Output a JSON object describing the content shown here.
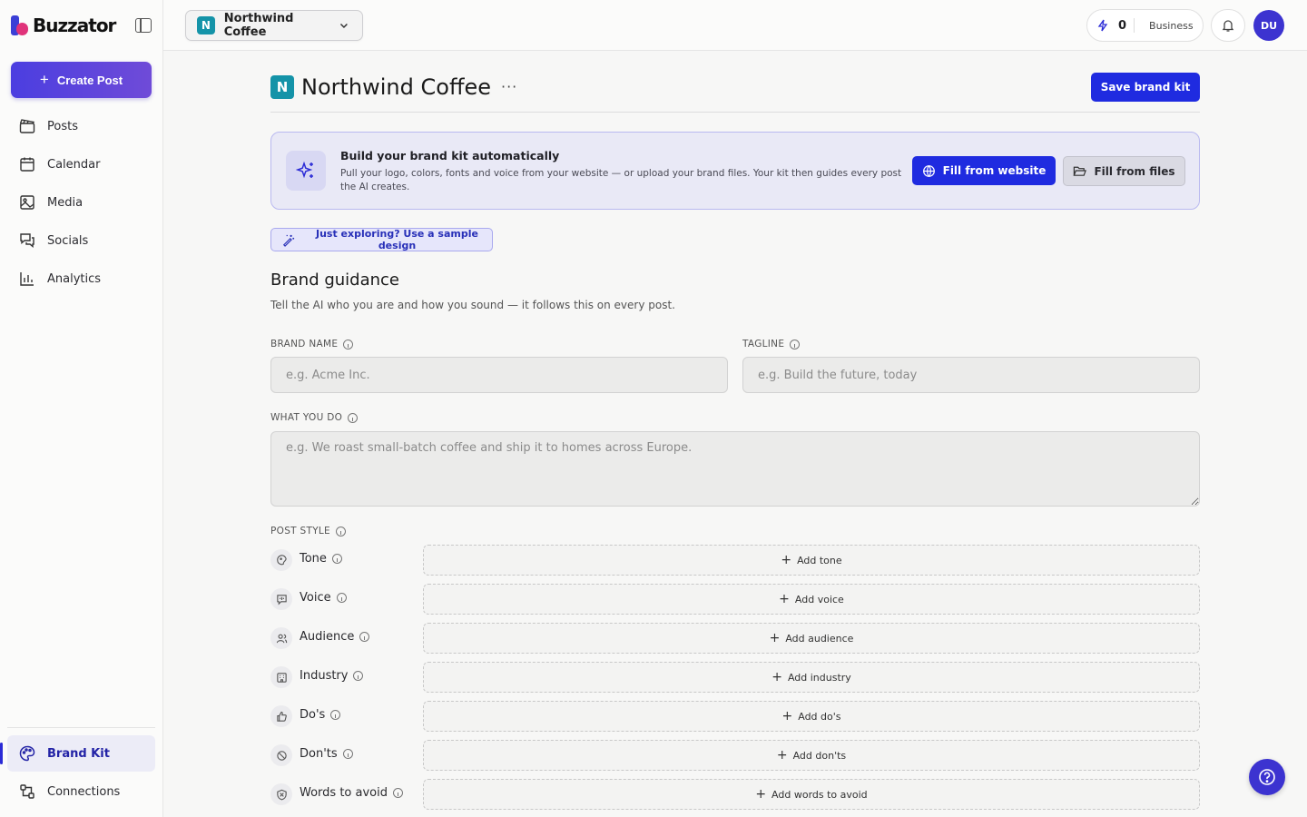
{
  "app": {
    "logo_text": "Buzzator"
  },
  "sidebar": {
    "create_label": "Create Post",
    "items": [
      {
        "label": "Posts",
        "icon": "clapperboard-icon"
      },
      {
        "label": "Calendar",
        "icon": "calendar-icon"
      },
      {
        "label": "Media",
        "icon": "image-icon"
      },
      {
        "label": "Socials",
        "icon": "chat-icon"
      },
      {
        "label": "Analytics",
        "icon": "bar-chart-icon"
      }
    ],
    "bottom_items": [
      {
        "label": "Brand Kit",
        "icon": "palette-icon",
        "active": true
      },
      {
        "label": "Connections",
        "icon": "connections-icon"
      }
    ]
  },
  "topbar": {
    "workspace_initial": "N",
    "workspace_name": "Northwind Coffee",
    "credits": "0",
    "plan": "Business",
    "avatar": "DU"
  },
  "page": {
    "initial": "N",
    "title": "Northwind Coffee",
    "more": "···",
    "save_label": "Save brand kit"
  },
  "auto": {
    "title": "Build your brand kit automatically",
    "desc": "Pull your logo, colors, fonts and voice from your website — or upload your brand files. Your kit then guides every post the AI creates.",
    "fill_web": "Fill from website",
    "fill_files": "Fill from files"
  },
  "sample_label": "Just exploring? Use a sample design",
  "guidance": {
    "title": "Brand guidance",
    "subtitle": "Tell the AI who you are and how you sound — it follows this on every post.",
    "brand_name_label": "BRAND NAME",
    "brand_name_placeholder": "e.g. Acme Inc.",
    "tagline_label": "TAGLINE",
    "tagline_placeholder": "e.g. Build the future, today",
    "what_label": "WHAT YOU DO",
    "what_placeholder": "e.g. We roast small-batch coffee and ship it to homes across Europe.",
    "post_style_label": "POST STYLE",
    "style_rows": [
      {
        "label": "Tone",
        "add": "Add tone",
        "icon": "tone-icon"
      },
      {
        "label": "Voice",
        "add": "Add voice",
        "icon": "voice-icon"
      },
      {
        "label": "Audience",
        "add": "Add audience",
        "icon": "audience-icon"
      },
      {
        "label": "Industry",
        "add": "Add industry",
        "icon": "industry-icon"
      },
      {
        "label": "Do's",
        "add": "Add do's",
        "icon": "thumbs-up-icon"
      },
      {
        "label": "Don'ts",
        "add": "Add don'ts",
        "icon": "ban-icon"
      },
      {
        "label": "Words to avoid",
        "add": "Add words to avoid",
        "icon": "shield-icon"
      }
    ]
  },
  "colors": {
    "accent": "#1f2be0",
    "brand_teal": "#1493a8",
    "avatar": "#3c33d0"
  }
}
